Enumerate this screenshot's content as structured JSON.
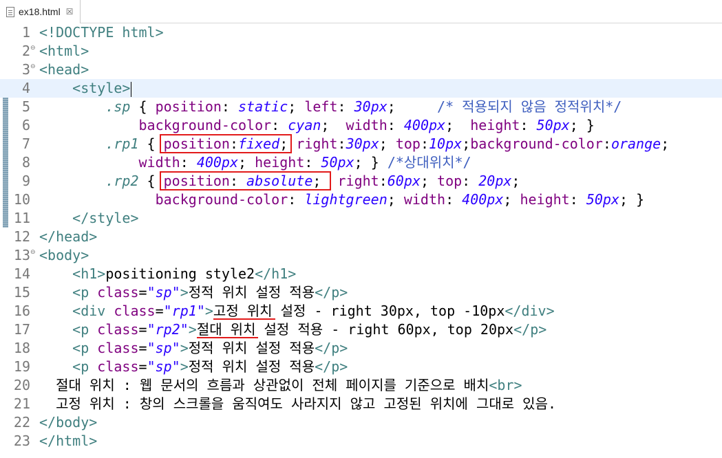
{
  "tab": {
    "label": "ex18.html",
    "close_glyph": "☒",
    "icon": "html-file-icon"
  },
  "colors": {
    "tag": "#3f7f7f",
    "attr": "#7f007f",
    "value": "#2a00ff",
    "text": "#000000",
    "comment": "#3f5fbf",
    "selector": "#3f7f7f",
    "line_number": "#787878",
    "highlight": "#e21a1a",
    "current_line": "#e8f2fe"
  },
  "editor": {
    "current_line": 4,
    "lines": [
      {
        "n": "1",
        "fold": "",
        "tokens": [
          [
            "<!DOCTYPE html>",
            "tag"
          ]
        ]
      },
      {
        "n": "2",
        "fold": "⊖",
        "tokens": [
          [
            "<html>",
            "tag"
          ]
        ]
      },
      {
        "n": "3",
        "fold": "⊖",
        "tokens": [
          [
            "<head>",
            "tag"
          ]
        ]
      },
      {
        "n": "4",
        "fold": "",
        "tokens": [
          [
            "    ",
            ""
          ],
          [
            "<style>",
            "tag"
          ]
        ]
      },
      {
        "n": "5",
        "fold": "",
        "tokens": [
          [
            "        ",
            ""
          ],
          [
            ".sp",
            "sel"
          ],
          [
            " { ",
            "t"
          ],
          [
            "position",
            "prop"
          ],
          [
            ": ",
            "t"
          ],
          [
            "static",
            "val"
          ],
          [
            "; ",
            "t"
          ],
          [
            "left",
            "prop"
          ],
          [
            ": ",
            "t"
          ],
          [
            "30px",
            "val"
          ],
          [
            ";     ",
            "t"
          ],
          [
            "/* 적용되지 않음 정적위치*/",
            "cm"
          ]
        ]
      },
      {
        "n": "6",
        "fold": "",
        "tokens": [
          [
            "            ",
            ""
          ],
          [
            "background-color",
            "prop"
          ],
          [
            ": ",
            "t"
          ],
          [
            "cyan",
            "val"
          ],
          [
            ";  ",
            "t"
          ],
          [
            "width",
            "prop"
          ],
          [
            ": ",
            "t"
          ],
          [
            "400px",
            "val"
          ],
          [
            ";  ",
            "t"
          ],
          [
            "height",
            "prop"
          ],
          [
            ": ",
            "t"
          ],
          [
            "50px",
            "val"
          ],
          [
            "; }",
            "t"
          ]
        ]
      },
      {
        "n": "7",
        "fold": "",
        "tokens": [
          [
            "        ",
            ""
          ],
          [
            ".rp1",
            "sel"
          ],
          [
            " { ",
            "t"
          ],
          [
            "position",
            "prop"
          ],
          [
            ":",
            "t"
          ],
          [
            "fixed",
            "val"
          ],
          [
            "; ",
            "t"
          ],
          [
            "right",
            "prop"
          ],
          [
            ":",
            "t"
          ],
          [
            "30px",
            "val"
          ],
          [
            "; ",
            "t"
          ],
          [
            "top",
            "prop"
          ],
          [
            ":",
            "t"
          ],
          [
            "10px",
            "val"
          ],
          [
            ";",
            "t"
          ],
          [
            "background-color",
            "prop"
          ],
          [
            ":",
            "t"
          ],
          [
            "orange",
            "val"
          ],
          [
            ";",
            "t"
          ]
        ]
      },
      {
        "n": "8",
        "fold": "",
        "tokens": [
          [
            "            ",
            ""
          ],
          [
            "width",
            "prop"
          ],
          [
            ": ",
            "t"
          ],
          [
            "400px",
            "val"
          ],
          [
            "; ",
            "t"
          ],
          [
            "height",
            "prop"
          ],
          [
            ": ",
            "t"
          ],
          [
            "50px",
            "val"
          ],
          [
            "; } ",
            "t"
          ],
          [
            "/*상대위치*/",
            "cm"
          ]
        ]
      },
      {
        "n": "9",
        "fold": "",
        "tokens": [
          [
            "        ",
            ""
          ],
          [
            ".rp2",
            "sel"
          ],
          [
            " { ",
            "t"
          ],
          [
            "position",
            "prop"
          ],
          [
            ": ",
            "t"
          ],
          [
            "absolute",
            "val"
          ],
          [
            ";  ",
            "t"
          ],
          [
            "right",
            "prop"
          ],
          [
            ":",
            "t"
          ],
          [
            "60px",
            "val"
          ],
          [
            "; ",
            "t"
          ],
          [
            "top",
            "prop"
          ],
          [
            ": ",
            "t"
          ],
          [
            "20px",
            "val"
          ],
          [
            ";",
            "t"
          ]
        ]
      },
      {
        "n": "10",
        "fold": "",
        "tokens": [
          [
            "              ",
            ""
          ],
          [
            "background-color",
            "prop"
          ],
          [
            ": ",
            "t"
          ],
          [
            "lightgreen",
            "val"
          ],
          [
            "; ",
            "t"
          ],
          [
            "width",
            "prop"
          ],
          [
            ": ",
            "t"
          ],
          [
            "400px",
            "val"
          ],
          [
            "; ",
            "t"
          ],
          [
            "height",
            "prop"
          ],
          [
            ": ",
            "t"
          ],
          [
            "50px",
            "val"
          ],
          [
            "; }",
            "t"
          ]
        ]
      },
      {
        "n": "11",
        "fold": "",
        "tokens": [
          [
            "    ",
            ""
          ],
          [
            "</style>",
            "tag"
          ]
        ]
      },
      {
        "n": "12",
        "fold": "",
        "tokens": [
          [
            "</head>",
            "tag"
          ]
        ]
      },
      {
        "n": "13",
        "fold": "⊖",
        "tokens": [
          [
            "<body>",
            "tag"
          ]
        ]
      },
      {
        "n": "14",
        "fold": "",
        "tokens": [
          [
            "    ",
            ""
          ],
          [
            "<h1>",
            "tag"
          ],
          [
            "positioning style2",
            "t"
          ],
          [
            "</h1>",
            "tag"
          ]
        ]
      },
      {
        "n": "15",
        "fold": "",
        "tokens": [
          [
            "    ",
            ""
          ],
          [
            "<p ",
            "tag"
          ],
          [
            "class",
            "attr"
          ],
          [
            "=",
            "t"
          ],
          [
            "\"sp\"",
            "val"
          ],
          [
            ">",
            "tag"
          ],
          [
            "정적 위치 설정 적용",
            "t"
          ],
          [
            "</p>",
            "tag"
          ]
        ]
      },
      {
        "n": "16",
        "fold": "",
        "tokens": [
          [
            "    ",
            ""
          ],
          [
            "<div ",
            "tag"
          ],
          [
            "class",
            "attr"
          ],
          [
            "=",
            "t"
          ],
          [
            "\"rp1\"",
            "val"
          ],
          [
            ">",
            "tag"
          ],
          [
            "고정 위치 설정 - right 30px, top -10px",
            "t"
          ],
          [
            "</div>",
            "tag"
          ]
        ]
      },
      {
        "n": "17",
        "fold": "",
        "tokens": [
          [
            "    ",
            ""
          ],
          [
            "<p ",
            "tag"
          ],
          [
            "class",
            "attr"
          ],
          [
            "=",
            "t"
          ],
          [
            "\"rp2\"",
            "val"
          ],
          [
            ">",
            "tag"
          ],
          [
            "절대 위치 설정 적용 - right 60px, top 20px",
            "t"
          ],
          [
            "</p>",
            "tag"
          ]
        ]
      },
      {
        "n": "18",
        "fold": "",
        "tokens": [
          [
            "    ",
            ""
          ],
          [
            "<p ",
            "tag"
          ],
          [
            "class",
            "attr"
          ],
          [
            "=",
            "t"
          ],
          [
            "\"sp\"",
            "val"
          ],
          [
            ">",
            "tag"
          ],
          [
            "정적 위치 설정 적용",
            "t"
          ],
          [
            "</p>",
            "tag"
          ]
        ]
      },
      {
        "n": "19",
        "fold": "",
        "tokens": [
          [
            "    ",
            ""
          ],
          [
            "<p ",
            "tag"
          ],
          [
            "class",
            "attr"
          ],
          [
            "=",
            "t"
          ],
          [
            "\"sp\"",
            "val"
          ],
          [
            ">",
            "tag"
          ],
          [
            "정적 위치 설정 적용",
            "t"
          ],
          [
            "</p>",
            "tag"
          ]
        ]
      },
      {
        "n": "20",
        "fold": "",
        "tokens": [
          [
            "  ",
            ""
          ],
          [
            "절대 위치 : 웹 문서의 흐름과 상관없이 전체 페이지를 기준으로 배치",
            "t"
          ],
          [
            "<br>",
            "tag"
          ]
        ]
      },
      {
        "n": "21",
        "fold": "",
        "tokens": [
          [
            "  ",
            ""
          ],
          [
            "고정 위치 : 창의 스크롤을 움직여도 사라지지 않고 고정된 위치에 그대로 있음.",
            "t"
          ]
        ]
      },
      {
        "n": "22",
        "fold": "",
        "tokens": [
          [
            "</body>",
            "tag"
          ]
        ]
      },
      {
        "n": "23",
        "fold": "",
        "tokens": [
          [
            "</html>",
            "tag"
          ]
        ]
      }
    ]
  }
}
